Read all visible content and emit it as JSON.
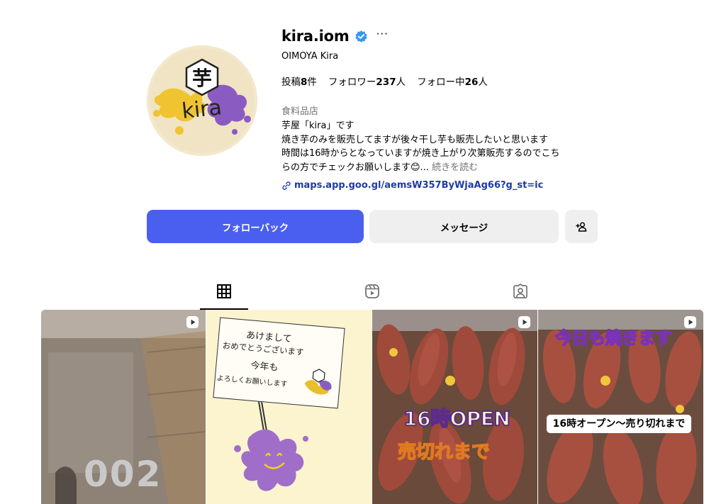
{
  "profile": {
    "username": "kira.iom",
    "more_label": "···",
    "full_name": "OIMOYA Kira",
    "stats": {
      "posts_prefix": "投稿",
      "posts_count": "8",
      "posts_suffix": "件",
      "followers_prefix": "フォロワー",
      "followers_count": "237",
      "followers_suffix": "人",
      "following_prefix": "フォロー中",
      "following_count": "26",
      "following_suffix": "人"
    },
    "category": "食料品店",
    "bio_line1": "芋屋「kira」です",
    "bio_line2": "焼き芋のみを販売してますが後々干し芋も販売したいと思います",
    "bio_line3": "時間は16時からとなっていますが焼き上がり次第販売するのでこち",
    "bio_line4": "らの方でチェックお願いします😊...",
    "bio_more": "続きを読む",
    "link": "maps.app.goo.gl/aemsW357ByWjaAg66?g_st=ic",
    "avatar_text_top": "芋",
    "avatar_text_main": "kira"
  },
  "actions": {
    "follow_back": "フォローバック",
    "message": "メッセージ",
    "suggest_icon": "person-add-icon"
  },
  "tabs": [
    {
      "name": "posts",
      "icon": "grid-icon",
      "active": true
    },
    {
      "name": "reels",
      "icon": "reels-icon",
      "active": false
    },
    {
      "name": "tagged",
      "icon": "tagged-icon",
      "active": false
    }
  ],
  "posts": [
    {
      "overlay_text": "002",
      "is_reel": true
    },
    {
      "sign_line1": "あけまして",
      "sign_line2": "おめでとうございます",
      "sign_line3": "今年も",
      "sign_line4": "よろしくお願いします",
      "is_reel": false
    },
    {
      "overlay_text1": "16時OPEN",
      "overlay_text2": "売切れまで",
      "is_reel": true
    },
    {
      "overlay_top": "今日も焼きます",
      "overlay_label": "16時オープン〜売り切れまで",
      "is_reel": true
    }
  ],
  "colors": {
    "primary_button": "#4a5ff0",
    "secondary_button": "#efefef",
    "verified_badge": "#3897f0",
    "link": "#1e3aa8"
  }
}
